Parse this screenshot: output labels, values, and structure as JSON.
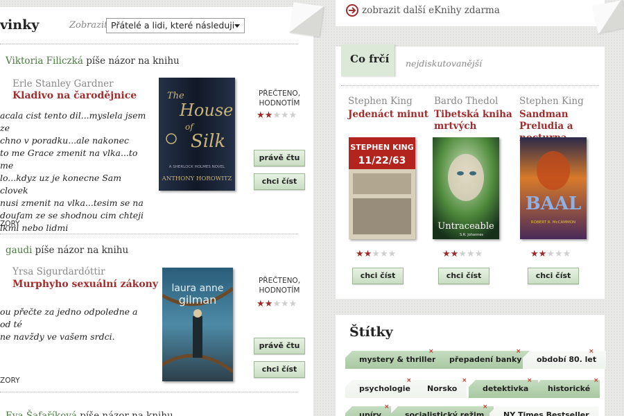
{
  "feed": {
    "title": "vinky",
    "show_label": "Zobrazit",
    "show_value": "Přátelé a lidi, které následuji",
    "items": [
      {
        "user": "Viktoria Filiczká",
        "action": " píše názor na knihu",
        "book_author": "Erle Stanley Gardner",
        "book_title": "Kladivo na čarodějnice",
        "review": "acala cist tento dil...myslela jsem ze\nchno v poradku...ale nakonec\nto me Grace zmenit na vlka...to me\nlo...kdyz uz je konecne Sam clovek\nnusi zmenit na vlka...tesim se na\ndoufam ze se shodnou cim chteji\nlkmi nebo lidmi",
        "status": "PŘEČTENO, HODNOTÍM",
        "rating": 2,
        "reading_label": "právě čtu",
        "want_label": "chci číst",
        "comments": "ZORY",
        "cover": {
          "line1": "The",
          "line2": "House",
          "line3": "of",
          "line4": "Silk",
          "series": "A SHERLOCK HOLMES NOVEL",
          "author": "ANTHONY HOROWITZ"
        }
      },
      {
        "user": "gaudi",
        "action": " píše názor na knihu",
        "book_author": "Yrsa Sigurdardóttir",
        "book_title": "Murphyho sexuální zákony",
        "review": "ou přečte za jedno odpoledne a od té\nne navždy ve vašem srdci.",
        "status": "PŘEČTENO, HODNOTÍM",
        "rating": 2,
        "reading_label": "právě čtu",
        "want_label": "chci číst",
        "comments": "ZORY",
        "cover": {
          "line1": "laura anne",
          "line2": "gilman"
        }
      },
      {
        "user": "Eva Šafaříková",
        "action": " píše názor na knihu"
      }
    ]
  },
  "more_link": "zobrazit další eKnihy zdarma",
  "hot": {
    "tab": "Co frčí",
    "subtitle": "nejdiskutovanější",
    "books": [
      {
        "author": "Stephen King",
        "title": "Jedenáct minut",
        "rating": 2,
        "want_label": "chci číst",
        "cover": {
          "a": "STEPHEN KING",
          "b": "11/22/63"
        }
      },
      {
        "author": "Bardo Thedol",
        "title": "Tibetská kniha mrtvých",
        "rating": 2,
        "want_label": "chci číst",
        "cover": {
          "a": "Untraceable",
          "b": "S.R. Johannes"
        }
      },
      {
        "author": "Stephen King",
        "title": "Sandman Preludia a nocturna",
        "rating": 2,
        "want_label": "chci číst",
        "cover": {
          "a": "BAAL",
          "b": "ROBERT R. McCAMMON"
        }
      }
    ]
  },
  "tags": {
    "title": "Štítky",
    "items": [
      {
        "label": "mystery & thriller",
        "style": "green"
      },
      {
        "label": "přepadení banky",
        "style": "green"
      },
      {
        "label": "období 80. let",
        "style": "light"
      },
      {
        "label": "psychologie",
        "style": "light"
      },
      {
        "label": "Norsko",
        "style": "light"
      },
      {
        "label": "detektivka",
        "style": "green"
      },
      {
        "label": "historické",
        "style": "green"
      },
      {
        "label": "upíry",
        "style": "green"
      },
      {
        "label": "socialistický režim",
        "style": "green"
      },
      {
        "label": "NY Times Bestseller",
        "style": "light"
      }
    ]
  },
  "colors": {
    "accent": "#a02c2c",
    "user_link": "#4a7a3f",
    "button_green": "#c9ddc2"
  }
}
